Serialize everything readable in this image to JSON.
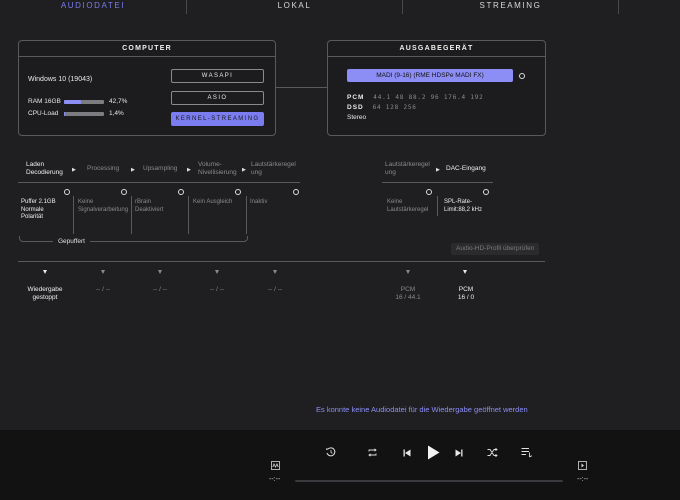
{
  "tabs": [
    {
      "label": "AUDIODATEI",
      "active": true
    },
    {
      "label": "LOKAL",
      "active": false
    },
    {
      "label": "STREAMING",
      "active": false
    }
  ],
  "computer": {
    "title": "COMPUTER",
    "os": "Windows 10 (19043)",
    "ram_label": "RAM 16GB",
    "ram_value": "42,7%",
    "ram_fraction": 0.427,
    "cpu_label": "CPU-Load",
    "cpu_value": "1,4%",
    "cpu_fraction": 0.014,
    "modes": [
      {
        "label": "WASAPI",
        "active": false
      },
      {
        "label": "ASIO",
        "active": false
      },
      {
        "label": "KERNEL-STREAMING",
        "active": true
      }
    ]
  },
  "output": {
    "title": "AUSGABEGERÄT",
    "device": "MADI (9-16) (RME HDSPe MADI FX)",
    "pcm_label": "PCM",
    "pcm_rates": "44.1  48  88.2  96  176.4  192",
    "dsd_label": "DSD",
    "dsd_rates": "64  128  256",
    "channels": "Stereo"
  },
  "pipeline": {
    "stages": [
      {
        "label": "Laden\nDecodierung",
        "highlight": true
      },
      {
        "label": "Processing",
        "highlight": false
      },
      {
        "label": "Upsampling",
        "highlight": false
      },
      {
        "label": "Volume-\nNivellisierung",
        "highlight": false
      },
      {
        "label": "Lautstärkeregel\nung",
        "highlight": false
      }
    ],
    "device_stages": [
      {
        "label": "Lautstärkeregel\nung",
        "highlight": false
      },
      {
        "label": "DAC-Eingang",
        "highlight": true
      }
    ],
    "cells": [
      {
        "text": "Puffer 2.1GB\nNormale\nPolarität",
        "highlight": true
      },
      {
        "text": "Keine\nSignalverarbeitung",
        "highlight": false
      },
      {
        "text": "rBrain\nDeaktiviert",
        "highlight": false
      },
      {
        "text": "Kein Ausgleich",
        "highlight": false
      },
      {
        "text": "Inaktiv",
        "highlight": false
      }
    ],
    "device_cells": [
      {
        "text": "Keine\nLautstärkeregel",
        "highlight": false
      },
      {
        "text": "SPL-Rate-\nLimit:88,2 kHz",
        "highlight": true
      }
    ],
    "buffer_label": "Gepuffert",
    "check_button": "Audio-HD-Profil überprüfen"
  },
  "status": {
    "items": [
      {
        "text": "Wiedergabe\ngestoppt",
        "highlight": true
      },
      {
        "text": "-- / --",
        "highlight": false
      },
      {
        "text": "-- / --",
        "highlight": false
      },
      {
        "text": "-- / --",
        "highlight": false
      },
      {
        "text": "-- / --",
        "highlight": false
      }
    ],
    "device_items": [
      {
        "text": "PCM\n16 / 44.1",
        "highlight": false
      },
      {
        "text": "PCM\n16 / 0",
        "highlight": true
      }
    ]
  },
  "message": "Es konnte keine Audiodatei für die Wiedergabe geöffnet werden",
  "player": {
    "time_elapsed": "--:--",
    "time_remaining": "--:--",
    "icons": [
      "waveform-icon",
      "replay-icon",
      "repeat-icon",
      "previous-icon",
      "play-icon",
      "next-icon",
      "shuffle-icon",
      "queue-icon",
      "export-icon"
    ]
  },
  "colors": {
    "accent": "#8c8ef5",
    "background": "#1f1f21",
    "player_background": "#121213"
  }
}
